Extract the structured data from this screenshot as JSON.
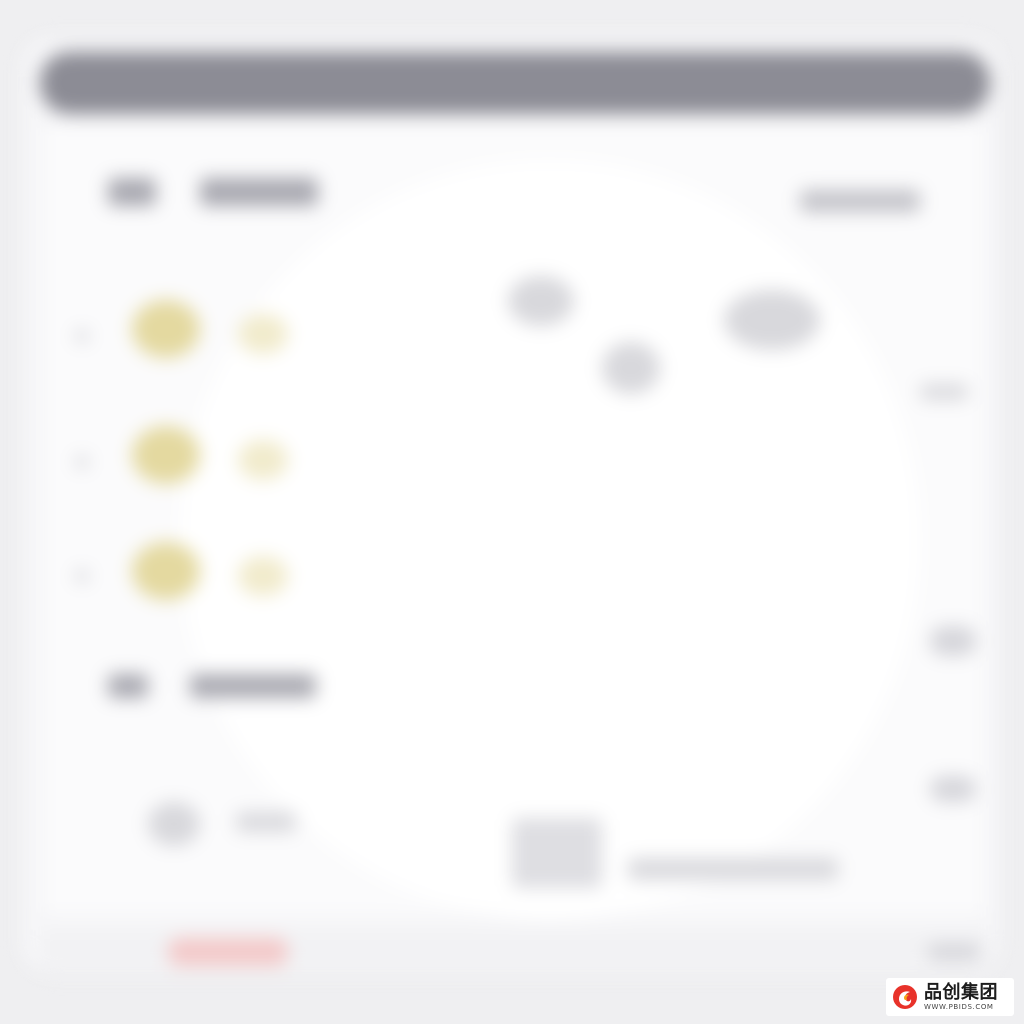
{
  "window": {
    "background_color": "#efeff1",
    "titlebar_color": "#8c8c95"
  },
  "accent_colors": {
    "coin": "#e4d9a0",
    "footer_highlight": "#f3c9c9"
  },
  "watermark": {
    "title": "品创集团",
    "subtitle": "WWW.PBIDS.COM",
    "logo_icon": "flame-logo-icon",
    "logo_colors": [
      "#e8322a",
      "#f5a31a"
    ]
  }
}
